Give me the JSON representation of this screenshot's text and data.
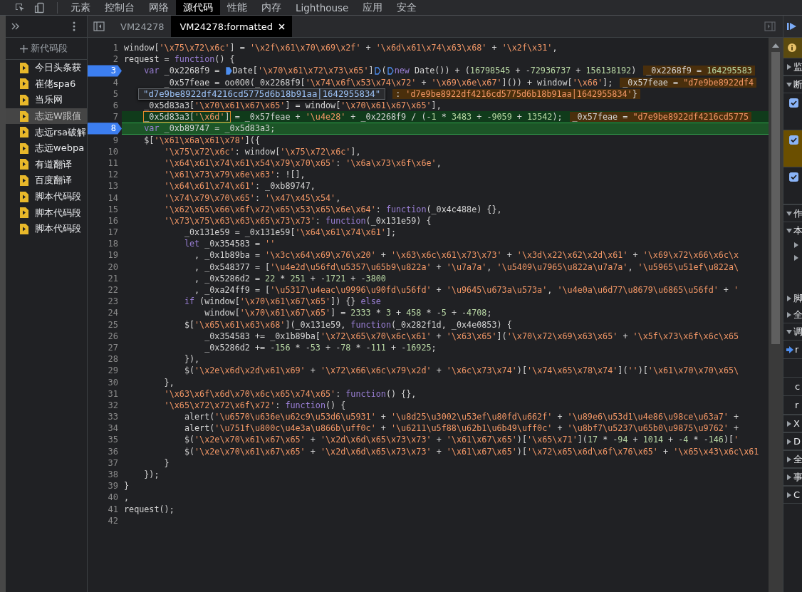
{
  "toolbar": {
    "tabs": [
      {
        "label": "元素",
        "selected": false
      },
      {
        "label": "控制台",
        "selected": false
      },
      {
        "label": "网络",
        "selected": false
      },
      {
        "label": "源代码",
        "selected": true
      },
      {
        "label": "性能",
        "selected": false
      },
      {
        "label": "内存",
        "selected": false
      },
      {
        "label": "Lighthouse",
        "selected": false
      },
      {
        "label": "应用",
        "selected": false
      },
      {
        "label": "安全",
        "selected": false
      }
    ]
  },
  "sidebar": {
    "new_snippet": "新代码段",
    "snippets": [
      {
        "label": "今日头条获",
        "selected": false
      },
      {
        "label": "崔佬spa6",
        "selected": false
      },
      {
        "label": "当乐网",
        "selected": false
      },
      {
        "label": "志远W跟值",
        "selected": true
      },
      {
        "label": "志远rsa破解",
        "selected": false
      },
      {
        "label": "志远webpa",
        "selected": false
      },
      {
        "label": "有道翻译",
        "selected": false
      },
      {
        "label": "百度翻译",
        "selected": false
      },
      {
        "label": "脚本代码段",
        "selected": false
      },
      {
        "label": "脚本代码段",
        "selected": false
      },
      {
        "label": "脚本代码段",
        "selected": false
      }
    ]
  },
  "editor": {
    "tabs": [
      {
        "label": "VM24278",
        "selected": false,
        "closable": false
      },
      {
        "label": "VM24278:formatted",
        "selected": true,
        "closable": true
      }
    ],
    "tooltip": "\"d7e9be8922df4216cd5775d6b18b91aa│1642955834\"",
    "lines": [
      {
        "n": "1",
        "bp": false,
        "code": [
          "window['\\x75\\x72\\x6c'] = '\\x2f\\x61\\x70\\x69\\x2f' + '\\x6d\\x61\\x74\\x63\\x68' + '\\x2f\\x31',"
        ]
      },
      {
        "n": "2",
        "bp": false,
        "code": [
          "request = ",
          {
            "kind": "kw",
            "text": "function"
          },
          "() {"
        ]
      },
      {
        "n": "3",
        "bp": true,
        "code": [
          {
            "kind": "kw",
            "text": "    var"
          },
          " _0x2268f9 = ",
          {
            "kind": "marker",
            "on": true
          },
          "Date['\\x70\\x61\\x72\\x73\\x65']",
          {
            "kind": "marker",
            "on": false
          },
          "(",
          {
            "kind": "marker",
            "on": false
          },
          {
            "kind": "kw",
            "text": "new"
          },
          " Date()) + (16798545 + -72936737 + 156138192)"
        ],
        "inline": "_0x2268f9 = 164295583"
      },
      {
        "n": "4",
        "bp": false,
        "code": [
          "        _0x57feae = oo0O0(_0x2268f9['\\x74\\x6f\\x53\\x74\\x72' + '\\x69\\x6e\\x67']()) + window['\\x66'];"
        ],
        "inline": "_0x57feae = \"d7e9be8922df4"
      },
      {
        "n": "5",
        "bp": false,
        "inline": ": 'd7e9be8922df4216cd5775d6b18b91aa│1642955834'}"
      },
      {
        "n": "6",
        "bp": false,
        "code": [
          "    _0x5d83a3['\\x70\\x61\\x67\\x65'] = window['\\x70\\x61\\x67\\x65'],"
        ]
      },
      {
        "n": "7",
        "bp": false,
        "kind": "evaluated",
        "code": [
          {
            "kind": "outlined",
            "text": "    _0x5d83a3['\\x6d']"
          },
          " = _0x57feae + '\\u4e28' + _0x2268f9 / (-1 * 3483 + -9059 + 13542);"
        ],
        "inline": "_0x57feae = \"d7e9be8922df4216cd5775"
      },
      {
        "n": "8",
        "bp": true,
        "kind": "paused",
        "code": [
          {
            "kind": "kw",
            "text": "    var"
          },
          " _0xb89747 = _0x5d83a3;"
        ]
      },
      {
        "n": "9",
        "bp": false,
        "code": [
          "    $['\\x61\\x6a\\x61\\x78']({"
        ]
      },
      {
        "n": "10",
        "bp": false,
        "code": [
          "        '\\x75\\x72\\x6c': window['\\x75\\x72\\x6c'],"
        ]
      },
      {
        "n": "11",
        "bp": false,
        "code": [
          "        '\\x64\\x61\\x74\\x61\\x54\\x79\\x70\\x65': '\\x6a\\x73\\x6f\\x6e',"
        ]
      },
      {
        "n": "12",
        "bp": false,
        "code": [
          "        '\\x61\\x73\\x79\\x6e\\x63': ![],"
        ]
      },
      {
        "n": "13",
        "bp": false,
        "code": [
          "        '\\x64\\x61\\x74\\x61': _0xb89747,"
        ]
      },
      {
        "n": "14",
        "bp": false,
        "code": [
          "        '\\x74\\x79\\x70\\x65': '\\x47\\x45\\x54',"
        ]
      },
      {
        "n": "15",
        "bp": false,
        "code": [
          "        '\\x62\\x65\\x66\\x6f\\x72\\x65\\x53\\x65\\x6e\\x64': ",
          {
            "kind": "kw",
            "text": "function"
          },
          "(_0x4c488e) {},"
        ]
      },
      {
        "n": "16",
        "bp": false,
        "code": [
          "        '\\x73\\x75\\x63\\x63\\x65\\x73\\x73': ",
          {
            "kind": "kw",
            "text": "function"
          },
          "(_0x131e59) {"
        ]
      },
      {
        "n": "17",
        "bp": false,
        "code": [
          "            _0x131e59 = _0x131e59['\\x64\\x61\\x74\\x61'];"
        ]
      },
      {
        "n": "18",
        "bp": false,
        "code": [
          {
            "kind": "kw",
            "text": "            let"
          },
          " _0x354583 = ''"
        ]
      },
      {
        "n": "19",
        "bp": false,
        "code": [
          "              , _0x1b89ba = '\\x3c\\x64\\x69\\x76\\x20' + '\\x63\\x6c\\x61\\x73\\x73' + '\\x3d\\x22\\x62\\x2d\\x61' + '\\x69\\x72\\x66\\x6c\\x"
        ]
      },
      {
        "n": "20",
        "bp": false,
        "code": [
          "              , _0x548377 = ['\\u4e2d\\u56fd\\u5357\\u65b9\\u822a' + '\\u7a7a', '\\u5409\\u7965\\u822a\\u7a7a', '\\u5965\\u51ef\\u822a\\"
        ]
      },
      {
        "n": "21",
        "bp": false,
        "code": [
          "              , _0x5286d2 = 22 * 251 + -1721 + -3800"
        ]
      },
      {
        "n": "22",
        "bp": false,
        "code": [
          "              , _0xa24ff9 = ['\\u5317\\u4eac\\u9996\\u90fd\\u56fd' + '\\u9645\\u673a\\u573a', '\\u4e0a\\u6d77\\u8679\\u6865\\u56fd' + '"
        ]
      },
      {
        "n": "23",
        "bp": false,
        "code": [
          {
            "kind": "kw",
            "text": "            if"
          },
          " (window['\\x70\\x61\\x67\\x65']) {} ",
          {
            "kind": "kw",
            "text": "else"
          }
        ]
      },
      {
        "n": "24",
        "bp": false,
        "code": [
          "                window['\\x70\\x61\\x67\\x65'] = 2333 * 3 + 458 * -5 + -4708;"
        ]
      },
      {
        "n": "25",
        "bp": false,
        "code": [
          "            $['\\x65\\x61\\x63\\x68'](_0x131e59, ",
          {
            "kind": "kw",
            "text": "function"
          },
          "(_0x282f1d, _0x4e0853) {"
        ]
      },
      {
        "n": "26",
        "bp": false,
        "code": [
          "                _0x354583 += _0x1b89ba['\\x72\\x65\\x70\\x6c\\x61' + '\\x63\\x65']('\\x70\\x72\\x69\\x63\\x65' + '\\x5f\\x73\\x6f\\x6c\\x65"
        ]
      },
      {
        "n": "27",
        "bp": false,
        "code": [
          "                _0x5286d2 += -156 * -53 + -78 * -111 + -16925;"
        ]
      },
      {
        "n": "28",
        "bp": false,
        "code": [
          "            }),"
        ]
      },
      {
        "n": "29",
        "bp": false,
        "code": [
          "            $('\\x2e\\x6d\\x2d\\x61\\x69' + '\\x72\\x66\\x6c\\x79\\x2d' + '\\x6c\\x73\\x74')['\\x74\\x65\\x78\\x74']('')['\\x61\\x70\\x70\\x65\\"
        ]
      },
      {
        "n": "30",
        "bp": false,
        "code": [
          "        },"
        ]
      },
      {
        "n": "31",
        "bp": false,
        "code": [
          "        '\\x63\\x6f\\x6d\\x70\\x6c\\x65\\x74\\x65': ",
          {
            "kind": "kw",
            "text": "function"
          },
          "() {},"
        ]
      },
      {
        "n": "32",
        "bp": false,
        "code": [
          "        '\\x65\\x72\\x72\\x6f\\x72': ",
          {
            "kind": "kw",
            "text": "function"
          },
          "() {"
        ]
      },
      {
        "n": "33",
        "bp": false,
        "code": [
          "            alert('\\u6570\\u636e\\u62c9\\u53d6\\u5931' + '\\u8d25\\u3002\\u53ef\\u80fd\\u662f' + '\\u89e6\\u53d1\\u4e86\\u98ce\\u63a7' +"
        ]
      },
      {
        "n": "34",
        "bp": false,
        "code": [
          "            alert('\\u751f\\u800c\\u4e3a\\u866b\\uff0c' + '\\u6211\\u5f88\\u62b1\\u6b49\\uff0c' + '\\u8bf7\\u5237\\u65b0\\u9875\\u9762' +"
        ]
      },
      {
        "n": "35",
        "bp": false,
        "code": [
          "            $('\\x2e\\x70\\x61\\x67\\x65' + '\\x2d\\x6d\\x65\\x73\\x73' + '\\x61\\x67\\x65')['\\x65\\x71'](17 * -94 + 1014 + -4 * -146)['"
        ]
      },
      {
        "n": "36",
        "bp": false,
        "code": [
          "            $('\\x2e\\x70\\x61\\x67\\x65' + '\\x2d\\x6d\\x65\\x73\\x73' + '\\x61\\x67\\x65')['\\x72\\x65\\x6d\\x6f\\x76\\x65' + '\\x65\\x43\\x6c\\x61"
        ]
      },
      {
        "n": "37",
        "bp": false,
        "code": [
          "        }"
        ]
      },
      {
        "n": "38",
        "bp": false,
        "code": [
          "    });"
        ]
      },
      {
        "n": "39",
        "bp": false,
        "code": [
          "}"
        ]
      },
      {
        "n": "40",
        "bp": false,
        "code": [
          ","
        ]
      },
      {
        "n": "41",
        "bp": false,
        "code": [
          "request();"
        ]
      },
      {
        "n": "42",
        "bp": false
      }
    ]
  },
  "debugger": {
    "rows": [
      {
        "kind": "notice"
      },
      {
        "kind": "section",
        "expanded": false,
        "label": "监"
      },
      {
        "kind": "section",
        "expanded": true,
        "label": "断"
      },
      {
        "kind": "check",
        "checked": true,
        "selected": false
      },
      {
        "kind": "check",
        "checked": true,
        "selected": true
      },
      {
        "kind": "check",
        "checked": true,
        "selected": false
      },
      {
        "kind": "section",
        "expanded": true,
        "label": "作"
      },
      {
        "kind": "sub",
        "expanded": true,
        "label": "本"
      },
      {
        "kind": "leaf"
      },
      {
        "kind": "leaf"
      },
      {
        "kind": "gap"
      },
      {
        "kind": "sub",
        "expanded": false,
        "label": "脚"
      },
      {
        "kind": "sub",
        "expanded": false,
        "label": "全"
      },
      {
        "kind": "section",
        "expanded": true,
        "label": "调"
      },
      {
        "kind": "frame",
        "current": true,
        "label": "r"
      },
      {
        "kind": "frame",
        "current": false
      },
      {
        "kind": "frame",
        "current": false,
        "label": "c"
      },
      {
        "kind": "frame",
        "current": false,
        "label": "r"
      },
      {
        "kind": "section",
        "expanded": false,
        "label": "X"
      },
      {
        "kind": "section",
        "expanded": false,
        "label": "D"
      },
      {
        "kind": "section",
        "expanded": false,
        "label": "全"
      },
      {
        "kind": "section",
        "expanded": false,
        "label": "事"
      },
      {
        "kind": "section",
        "expanded": false,
        "label": "C"
      }
    ]
  }
}
